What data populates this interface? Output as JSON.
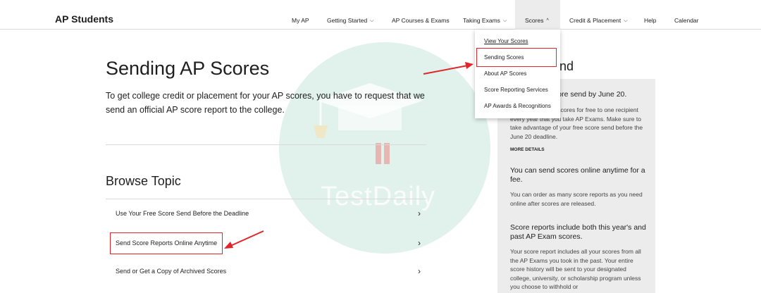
{
  "header": {
    "brand": "AP Students",
    "nav": [
      {
        "label": "My AP",
        "has_chevron": false
      },
      {
        "label": "Getting Started",
        "has_chevron": true
      },
      {
        "label": "AP Courses & Exams",
        "has_chevron": false
      },
      {
        "label": "Taking Exams",
        "has_chevron": true
      },
      {
        "label": "Scores",
        "has_chevron": true,
        "active": true
      },
      {
        "label": "Credit & Placement",
        "has_chevron": true
      },
      {
        "label": "Help",
        "has_chevron": false
      },
      {
        "label": "Calendar",
        "has_chevron": false
      }
    ]
  },
  "dropdown": {
    "items": [
      "View Your Scores",
      "Sending Scores",
      "About AP Scores",
      "Score Reporting Services",
      "AP Awards & Recognitions"
    ]
  },
  "main": {
    "title": "Sending AP Scores",
    "intro": "To get college credit or placement for your AP scores, you have to request that we send an official AP score report to the college.",
    "browse_title": "Browse Topic",
    "topics": [
      "Use Your Free Score Send Before the Deadline",
      "Send Score Reports Online Anytime",
      "Send or Get a Copy of Archived Scores"
    ]
  },
  "sidebar": {
    "heading_fragment": "ind",
    "sections": [
      {
        "head": "core send by June 20.",
        "body": "r scores for free to one recipient every year that you take AP Exams. Make sure to take advantage of your free score send before the June 20 deadline.",
        "more": "MORE DETAILS"
      },
      {
        "head": "You can send scores online anytime for a fee.",
        "body": "You can order as many score reports as you need online after scores are released."
      },
      {
        "head": "Score reports include both this year's and past AP Exam scores.",
        "body": "Your score report includes all your scores from all the AP Exams you took in the past. Your entire score history will be sent to your designated college, university, or scholarship program unless you choose to withhold or"
      }
    ]
  },
  "watermark": {
    "text": "TestDaily"
  },
  "colors": {
    "highlight": "#e0252b",
    "sidebar_bg": "#ececec",
    "active_nav_bg": "#ececec",
    "watermark": "#c8e6da"
  },
  "icons": {
    "chevron_down": "chevron-down-icon",
    "chevron_up": "chevron-up-icon",
    "chevron_right": "chevron-right-icon"
  }
}
